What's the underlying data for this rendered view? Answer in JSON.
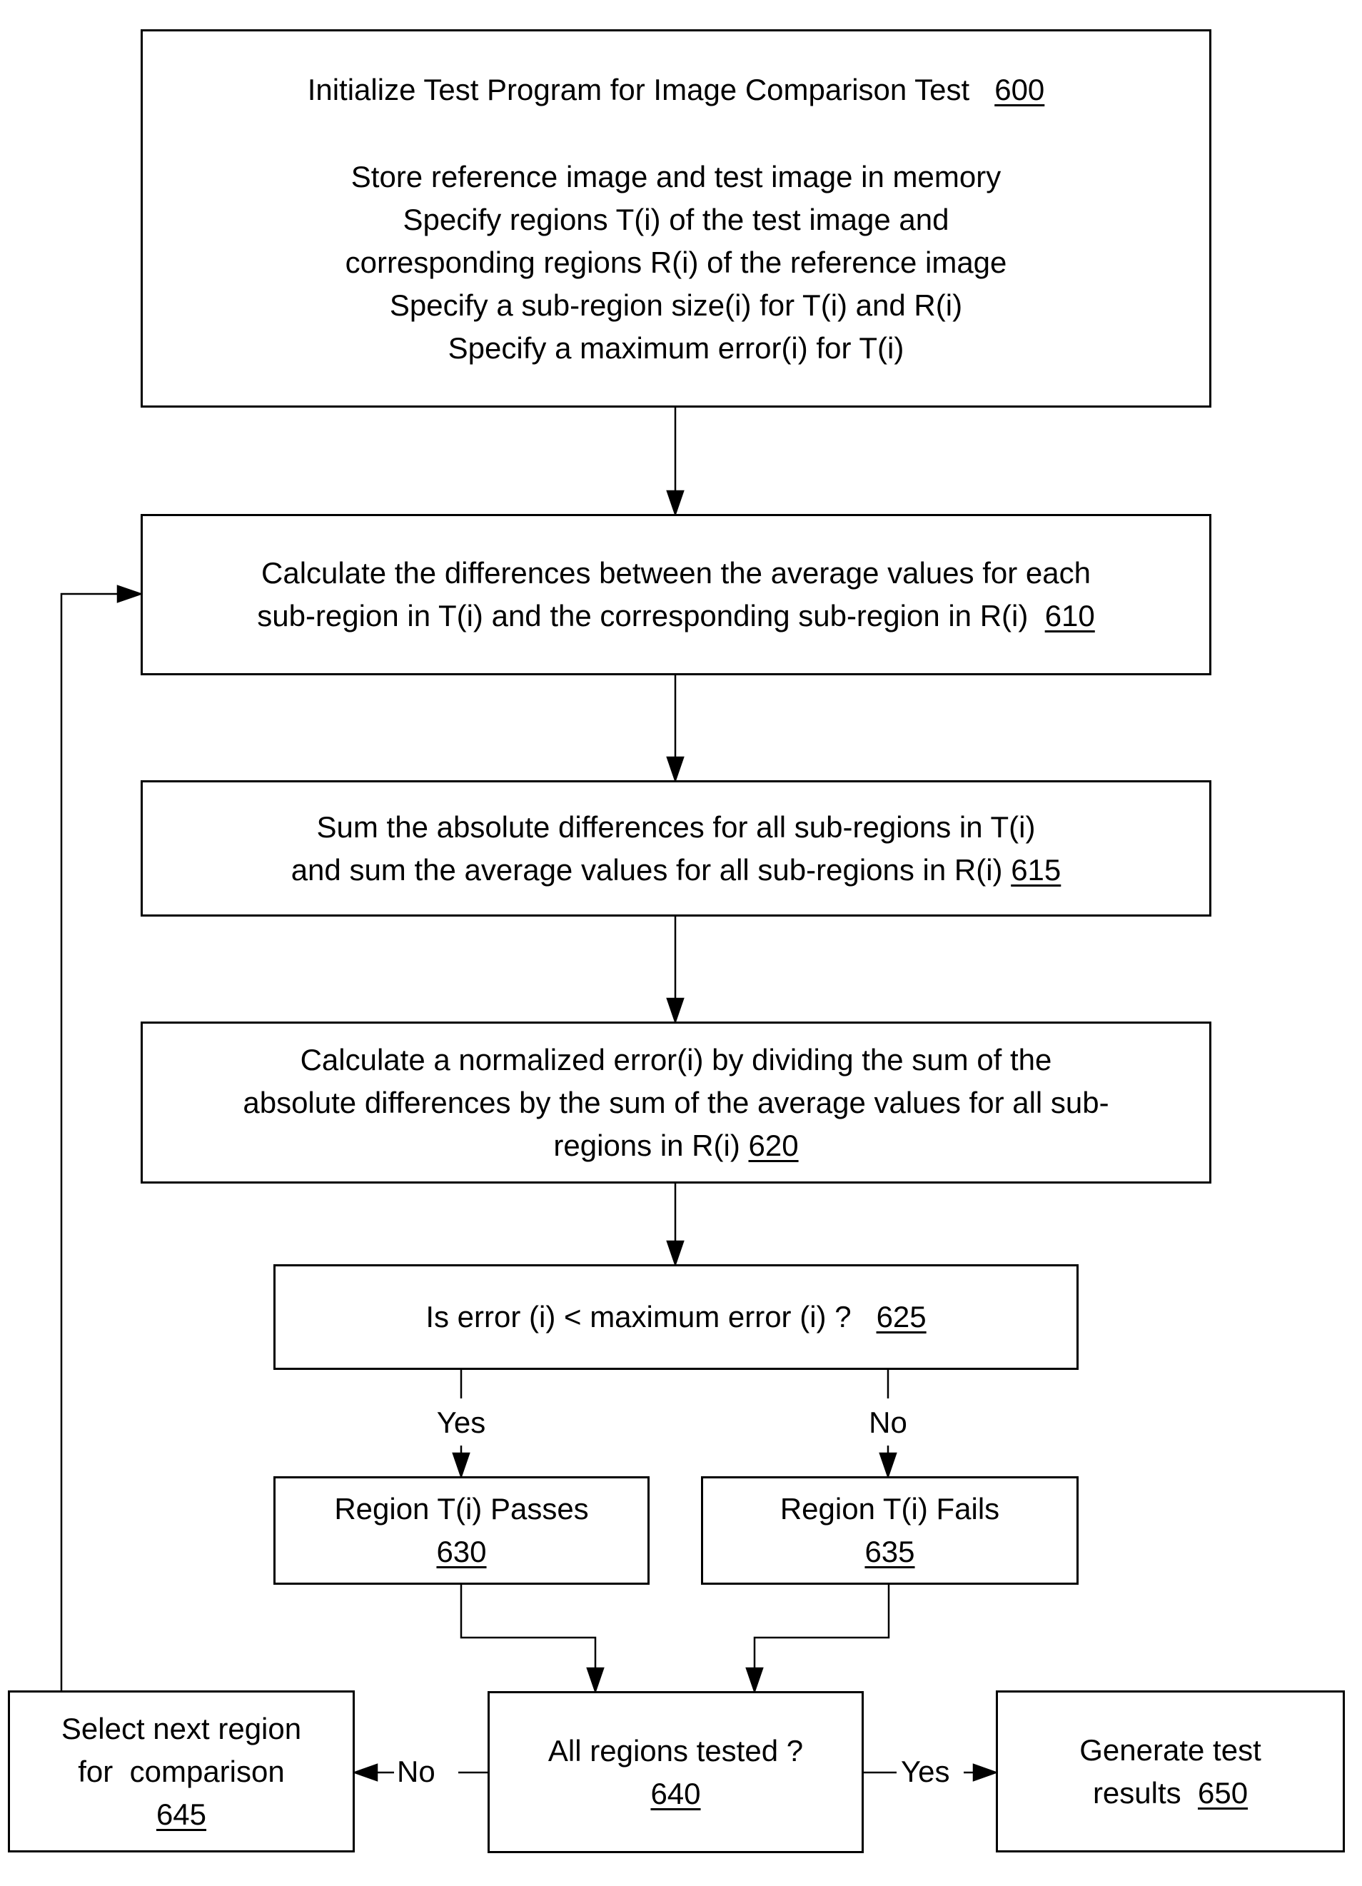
{
  "diagram": {
    "type": "flowchart",
    "steps": {
      "s600": {
        "title": "Initialize Test Program for Image Comparison Test",
        "ref": "600",
        "lines": [
          "Store reference image and test image in memory",
          "Specify regions T(i) of the test image and",
          "corresponding regions R(i) of the reference image",
          "Specify a sub-region size(i) for T(i) and R(i)",
          "Specify a maximum error(i) for T(i)"
        ]
      },
      "s610": {
        "lines": [
          "Calculate the differences between the average values for each",
          "sub-region in T(i) and the corresponding sub-region in R(i)"
        ],
        "ref": "610"
      },
      "s615": {
        "lines": [
          "Sum the absolute differences for all sub-regions in T(i)",
          "and sum the average values for all sub-regions in R(i)"
        ],
        "ref": "615"
      },
      "s620": {
        "lines": [
          "Calculate a normalized error(i) by dividing the sum of the",
          "absolute differences by the sum of the average values for all sub-",
          "regions in R(i)"
        ],
        "ref": "620"
      },
      "s625": {
        "text": "Is error (i) < maximum error (i) ?",
        "ref": "625"
      },
      "s630": {
        "text": "Region T(i) Passes",
        "ref": "630"
      },
      "s635": {
        "text": "Region T(i) Fails",
        "ref": "635"
      },
      "s640": {
        "text": "All regions tested ?",
        "ref": "640"
      },
      "s645": {
        "lines": [
          "Select next region",
          "for  comparison"
        ],
        "ref": "645"
      },
      "s650": {
        "lines": [
          "Generate test",
          "results"
        ],
        "ref": "650"
      }
    },
    "edge_labels": {
      "yes_625": "Yes",
      "no_625": "No",
      "no_640": "No",
      "yes_640": "Yes"
    },
    "edges": [
      {
        "from": "600",
        "to": "610"
      },
      {
        "from": "610",
        "to": "615"
      },
      {
        "from": "615",
        "to": "620"
      },
      {
        "from": "620",
        "to": "625"
      },
      {
        "from": "625",
        "to": "630",
        "label": "Yes"
      },
      {
        "from": "625",
        "to": "635",
        "label": "No"
      },
      {
        "from": "630",
        "to": "640"
      },
      {
        "from": "635",
        "to": "640"
      },
      {
        "from": "640",
        "to": "645",
        "label": "No"
      },
      {
        "from": "640",
        "to": "650",
        "label": "Yes"
      },
      {
        "from": "645",
        "to": "610"
      }
    ]
  }
}
